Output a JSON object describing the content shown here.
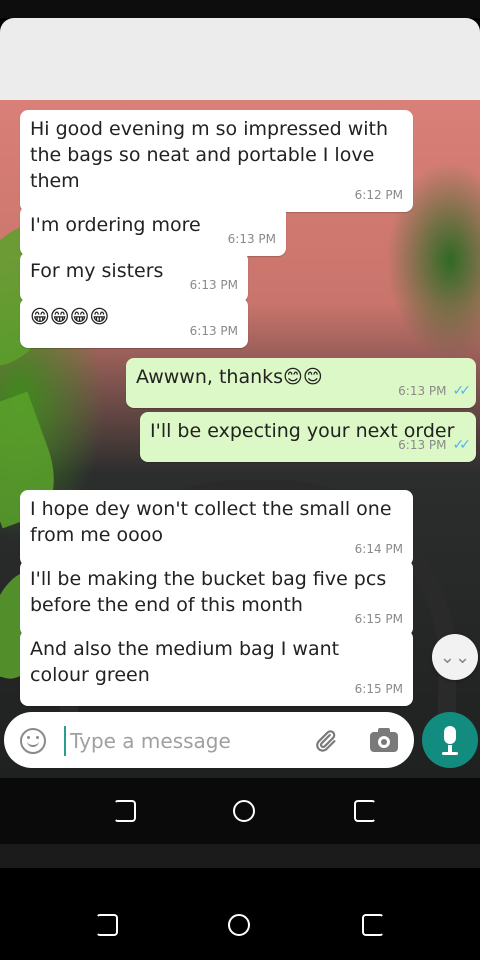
{
  "messages": [
    {
      "text": "Hi good evening m so impressed with the bags so neat and portable I love them",
      "time": "6:12 PM"
    },
    {
      "text": "I'm ordering more",
      "time": "6:13 PM"
    },
    {
      "text": "For my sisters",
      "time": "6:13 PM"
    },
    {
      "text": "😁😁😁😁",
      "time": "6:13 PM"
    },
    {
      "text": "Awwwn, thanks😊😊",
      "time": "6:13 PM"
    },
    {
      "text": "I'll be expecting your next order",
      "time": "6:13 PM"
    },
    {
      "text": "I hope dey won't collect the small one from me oooo",
      "time": "6:14 PM"
    },
    {
      "text": "I'll be making the bucket bag five pcs before the end of this month",
      "time": "6:15 PM"
    },
    {
      "text": "And also the medium bag I want colour green",
      "time": "6:15 PM"
    }
  ],
  "composer": {
    "placeholder": "Type a message"
  },
  "scroll_down_glyph": "⌄⌄",
  "read_receipt_glyph": "✓✓",
  "colors": {
    "incoming_bubble": "#ffffff",
    "outgoing_bubble": "#dcf8c6",
    "send_button": "#128c7e",
    "read_ticks": "#4fb6ec"
  }
}
